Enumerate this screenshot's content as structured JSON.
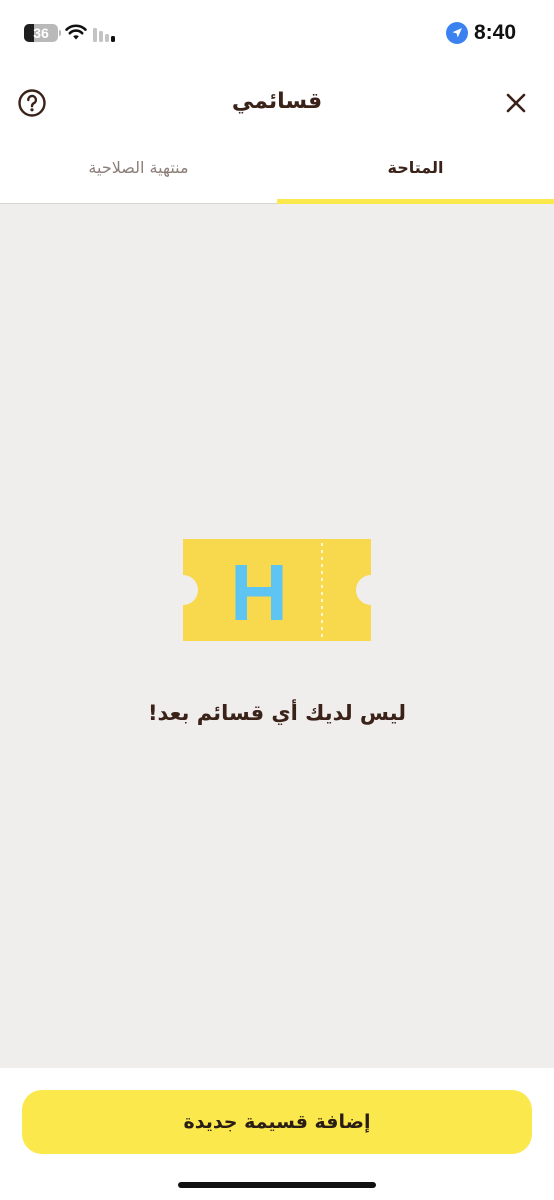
{
  "status_bar": {
    "battery_level": "36",
    "time": "8:40",
    "icons": [
      "wifi-icon",
      "cellular-signal-icon",
      "location-arrow-icon"
    ]
  },
  "header": {
    "title": "قسائمي",
    "help_icon": "question-circle-icon",
    "close_icon": "close-icon"
  },
  "tabs": [
    {
      "label": "منتهية الصلاحية",
      "active": false
    },
    {
      "label": "المتاحة",
      "active": true
    }
  ],
  "empty_state": {
    "illustration_icon": "voucher-ticket-icon",
    "illustration_letter": "H",
    "message": "ليس لديك أي قسائم بعد!"
  },
  "actions": {
    "add_voucher_label": "إضافة قسيمة جديدة"
  },
  "colors": {
    "accent_yellow": "#fae84d",
    "ticket_yellow": "#f8d94d",
    "ticket_letter_blue": "#5ec4f2",
    "text_brown": "#3a2219",
    "background_grey": "#f0eeec"
  }
}
